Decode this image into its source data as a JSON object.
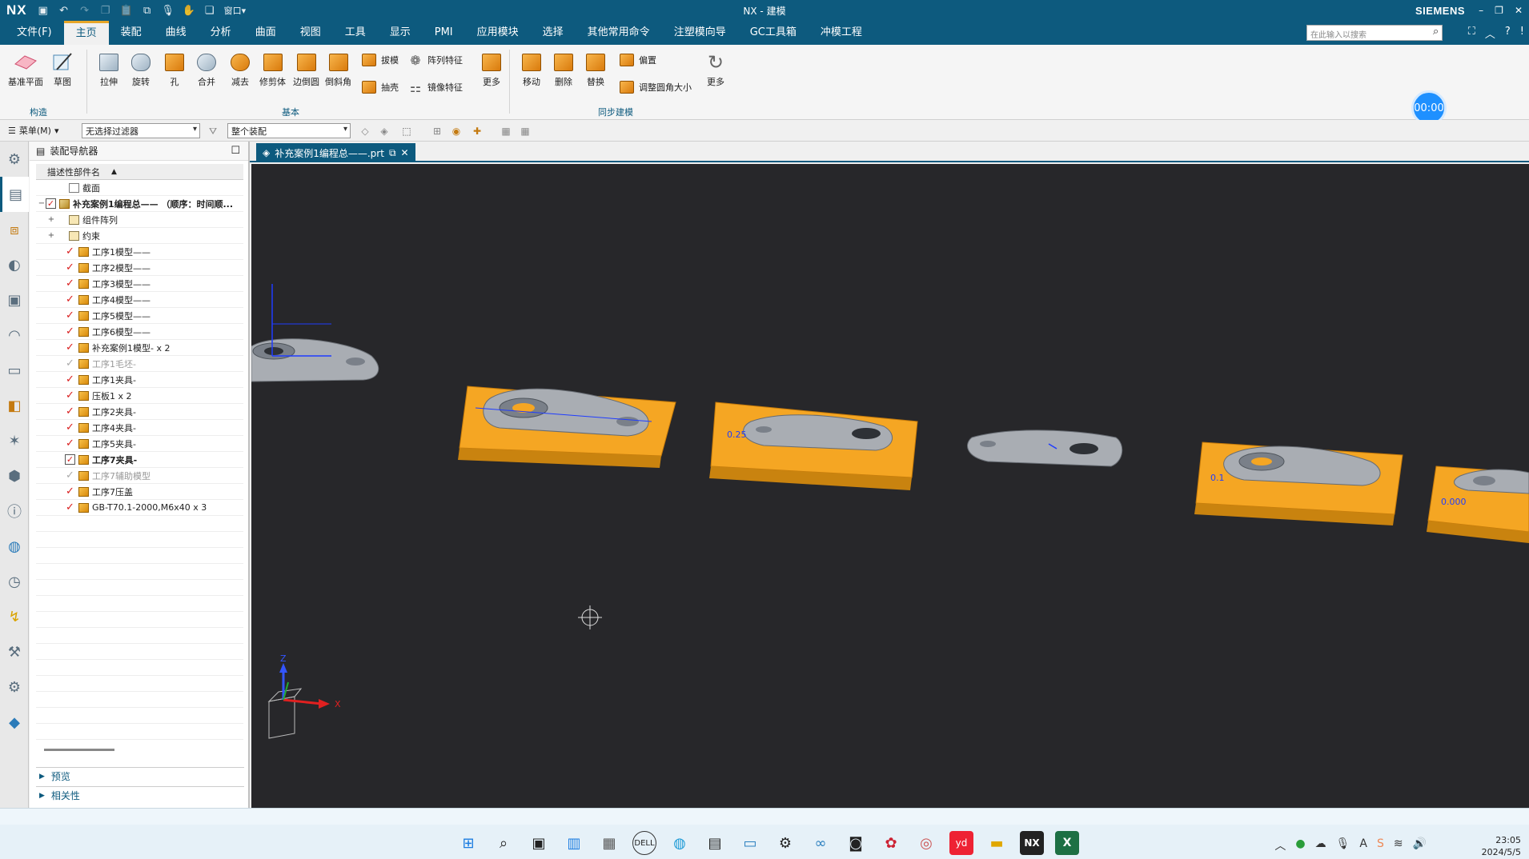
{
  "app": {
    "logo": "NX",
    "window_title": "NX - 建模",
    "brand": "SIEMENS"
  },
  "menu": {
    "items": [
      "文件(F)",
      "主页",
      "装配",
      "曲线",
      "分析",
      "曲面",
      "视图",
      "工具",
      "显示",
      "PMI",
      "应用模块",
      "选择",
      "其他常用命令",
      "注塑模向导",
      "GC工具箱",
      "冲模工程"
    ],
    "active_index": 1,
    "search_placeholder": "在此输入以搜索"
  },
  "ribbon": {
    "timer": "00:00",
    "construct": {
      "datum_plane": "基准平面",
      "sketch": "草图",
      "group_label": "构造"
    },
    "basic": {
      "extrude": "拉伸",
      "revolve": "旋转",
      "hole": "孔",
      "unite": "合并",
      "subtract": "减去",
      "trim_body": "修剪体",
      "edge_blend": "边倒圆",
      "chamfer": "倒斜角",
      "draft": "拔模",
      "pattern_feature": "阵列特征",
      "shell": "抽壳",
      "mirror_feature": "镜像特征",
      "more": "更多",
      "group_label": "基本"
    },
    "sync": {
      "move": "移动",
      "delete": "删除",
      "replace": "替换",
      "offset": "偏置",
      "resize_blend": "调整圆角大小",
      "group_label": "同步建模"
    },
    "more2": "更多"
  },
  "filterbar": {
    "menu_label": "菜单(M)",
    "type_filter": "无选择过滤器",
    "scope": "整个装配"
  },
  "navigator": {
    "title": "装配导航器",
    "column_header": "描述性部件名",
    "rows": [
      {
        "label": "截面",
        "check": "none",
        "icon": "folder",
        "indent": 1,
        "exp": ""
      },
      {
        "label": "补充案例1编程总—— （顺序：时间顺...",
        "check": "box",
        "icon": "asm",
        "indent": 0,
        "exp": "−",
        "bold": true
      },
      {
        "label": "组件阵列",
        "check": "none",
        "icon": "folder2",
        "indent": 1,
        "exp": "+"
      },
      {
        "label": "约束",
        "check": "none",
        "icon": "folder2",
        "indent": 1,
        "exp": "+"
      },
      {
        "label": "工序1模型——",
        "check": "red",
        "icon": "part",
        "indent": 2
      },
      {
        "label": "工序2模型——",
        "check": "red",
        "icon": "part",
        "indent": 2
      },
      {
        "label": "工序3模型——",
        "check": "red",
        "icon": "part",
        "indent": 2
      },
      {
        "label": "工序4模型——",
        "check": "red",
        "icon": "part",
        "indent": 2
      },
      {
        "label": "工序5模型——",
        "check": "red",
        "icon": "part",
        "indent": 2
      },
      {
        "label": "工序6模型——",
        "check": "red",
        "icon": "part",
        "indent": 2
      },
      {
        "label": "补充案例1模型- x 2",
        "check": "red",
        "icon": "part",
        "indent": 2
      },
      {
        "label": "工序1毛坯-",
        "check": "grey",
        "icon": "part",
        "indent": 2,
        "dim": true
      },
      {
        "label": "工序1夹具-",
        "check": "red",
        "icon": "part",
        "indent": 2
      },
      {
        "label": "压板1 x 2",
        "check": "red",
        "icon": "part",
        "indent": 2
      },
      {
        "label": "工序2夹具-",
        "check": "red",
        "icon": "part",
        "indent": 2
      },
      {
        "label": "工序4夹具-",
        "check": "red",
        "icon": "part",
        "indent": 2
      },
      {
        "label": "工序5夹具-",
        "check": "red",
        "icon": "part",
        "indent": 2
      },
      {
        "label": "工序7夹具-",
        "check": "box",
        "icon": "part",
        "indent": 2,
        "bold": true
      },
      {
        "label": "工序7辅助模型",
        "check": "grey",
        "icon": "part",
        "indent": 2,
        "dim": true
      },
      {
        "label": "工序7压盖",
        "check": "red",
        "icon": "part",
        "indent": 2
      },
      {
        "label": "GB-T70.1-2000,M6x40 x 3",
        "check": "red",
        "icon": "part",
        "indent": 2
      }
    ],
    "preview": "预览",
    "dependencies": "相关性"
  },
  "viewport": {
    "tab_label": "补充案例1编程总——.prt",
    "dim_labels": [
      "0.25",
      "0.1",
      "0.000"
    ],
    "axis_x": "X",
    "axis_z": "Z",
    "background": "#27272a",
    "fixture_color": "#f5a623",
    "part_color": "#a9adb3"
  },
  "taskbar": {
    "time": "23:05",
    "date": "2024/5/5"
  }
}
